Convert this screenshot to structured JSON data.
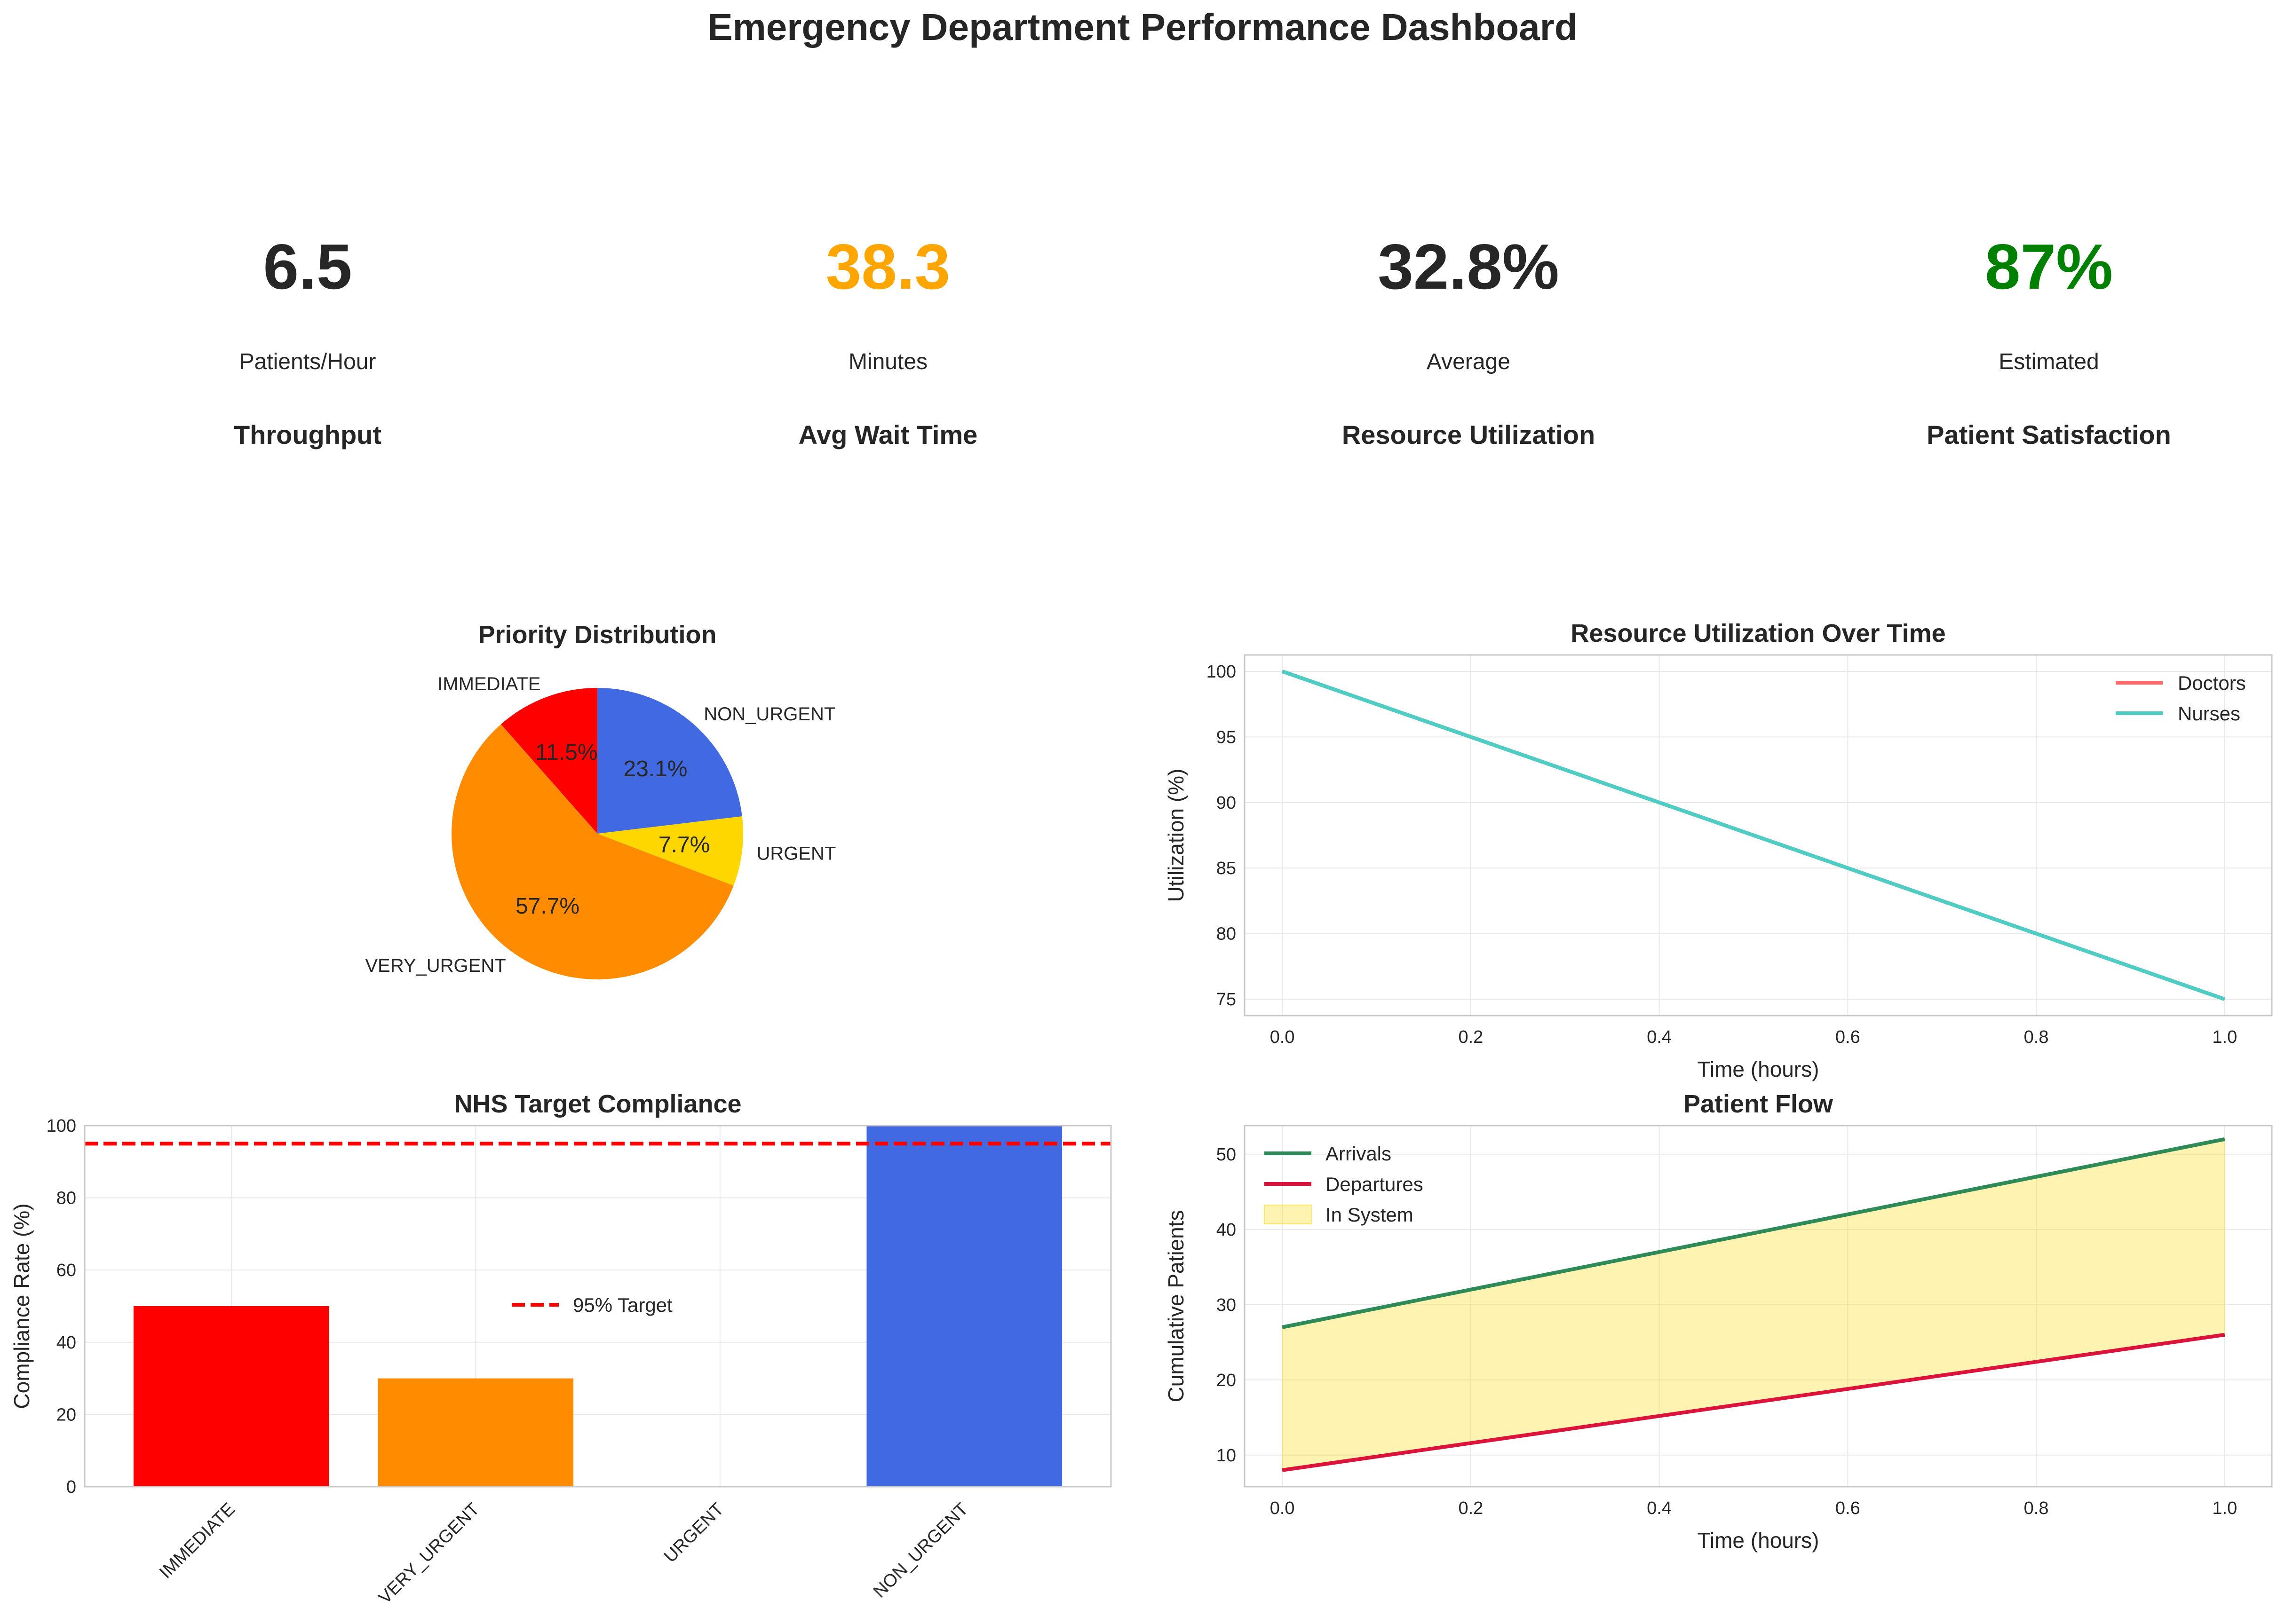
{
  "title": "Emergency Department Performance Dashboard",
  "kpis": [
    {
      "value": "6.5",
      "sub": "Patients/Hour",
      "label": "Throughput",
      "color": "#262626"
    },
    {
      "value": "38.3",
      "sub": "Minutes",
      "label": "Avg Wait Time",
      "color": "#FFA500"
    },
    {
      "value": "32.8%",
      "sub": "Average",
      "label": "Resource Utilization",
      "color": "#262626"
    },
    {
      "value": "87%",
      "sub": "Estimated",
      "label": "Patient Satisfaction",
      "color": "#008000"
    }
  ],
  "chart_data": [
    {
      "type": "pie",
      "title": "Priority Distribution",
      "slices": [
        {
          "label": "IMMEDIATE",
          "value": 11.5,
          "pct_label": "11.5%",
          "color": "#FF0000"
        },
        {
          "label": "VERY_URGENT",
          "value": 57.7,
          "pct_label": "57.7%",
          "color": "#FF8C00"
        },
        {
          "label": "URGENT",
          "value": 7.7,
          "pct_label": "7.7%",
          "color": "#FFD700"
        },
        {
          "label": "NON_URGENT",
          "value": 23.1,
          "pct_label": "23.1%",
          "color": "#4169E1"
        }
      ]
    },
    {
      "type": "line",
      "title": "Resource Utilization Over Time",
      "xlabel": "Time (hours)",
      "ylabel": "Utilization (%)",
      "xlim": [
        -0.04,
        1.05
      ],
      "ylim": [
        73.75,
        101.25
      ],
      "xticks": [
        "0.0",
        "0.2",
        "0.4",
        "0.6",
        "0.8",
        "1.0"
      ],
      "yticks": [
        "75",
        "80",
        "85",
        "90",
        "95",
        "100"
      ],
      "grid": true,
      "legend": "top-right",
      "series": [
        {
          "name": "Doctors",
          "color": "#FF6B6B",
          "x": [
            0,
            1
          ],
          "y": [
            100,
            75
          ]
        },
        {
          "name": "Nurses",
          "color": "#4ECDC4",
          "x": [
            0,
            1
          ],
          "y": [
            100,
            75
          ]
        }
      ]
    },
    {
      "type": "bar",
      "title": "NHS Target Compliance",
      "ylabel": "Compliance Rate (%)",
      "ylim": [
        0,
        100
      ],
      "yticks": [
        "0",
        "20",
        "40",
        "60",
        "80",
        "100"
      ],
      "categories": [
        "IMMEDIATE",
        "VERY_URGENT",
        "URGENT",
        "NON_URGENT"
      ],
      "values": [
        50,
        30,
        0,
        100
      ],
      "colors": [
        "#FF0000",
        "#FF8C00",
        "#FFD700",
        "#4169E1"
      ],
      "target": {
        "value": 95,
        "label": "95% Target",
        "color": "#FF0000"
      },
      "grid": true,
      "legend": "center"
    },
    {
      "type": "line",
      "title": "Patient Flow",
      "xlabel": "Time (hours)",
      "ylabel": "Cumulative Patients",
      "xlim": [
        -0.04,
        1.05
      ],
      "ylim": [
        5.8,
        53.8
      ],
      "xticks": [
        "0.0",
        "0.2",
        "0.4",
        "0.6",
        "0.8",
        "1.0"
      ],
      "yticks": [
        "10",
        "20",
        "30",
        "40",
        "50"
      ],
      "grid": true,
      "legend": "top-left",
      "series": [
        {
          "name": "Arrivals",
          "color": "#2E8B57",
          "x": [
            0,
            1
          ],
          "y": [
            27,
            52
          ]
        },
        {
          "name": "Departures",
          "color": "#DC143C",
          "x": [
            0,
            1
          ],
          "y": [
            8,
            26
          ]
        }
      ],
      "fill": {
        "name": "In System",
        "color": "#FFD700"
      }
    }
  ]
}
